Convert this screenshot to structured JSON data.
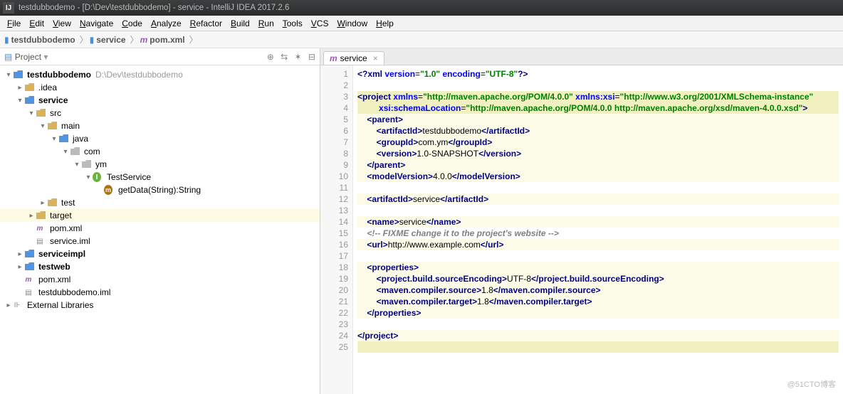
{
  "title": "testdubbodemo - [D:\\Dev\\testdubbodemo] - service - IntelliJ IDEA 2017.2.6",
  "menu": [
    "File",
    "Edit",
    "View",
    "Navigate",
    "Code",
    "Analyze",
    "Refactor",
    "Build",
    "Run",
    "Tools",
    "VCS",
    "Window",
    "Help"
  ],
  "breadcrumbs": [
    {
      "icon": "mod",
      "label": "testdubbodemo"
    },
    {
      "icon": "mod",
      "label": "service"
    },
    {
      "icon": "xml",
      "label": "pom.xml"
    }
  ],
  "sidebar": {
    "title": "Project"
  },
  "tree": [
    {
      "d": 0,
      "exp": "open",
      "icon": "mod",
      "label": "testdubbodemo",
      "suffix": "D:\\Dev\\testdubbodemo",
      "bold": true
    },
    {
      "d": 1,
      "exp": "closed",
      "icon": "fld",
      "label": ".idea"
    },
    {
      "d": 1,
      "exp": "open",
      "icon": "mod",
      "label": "service",
      "bold": true
    },
    {
      "d": 2,
      "exp": "open",
      "icon": "fld",
      "label": "src"
    },
    {
      "d": 3,
      "exp": "open",
      "icon": "fld",
      "label": "main"
    },
    {
      "d": 4,
      "exp": "open",
      "icon": "fldblue",
      "label": "java"
    },
    {
      "d": 5,
      "exp": "open",
      "icon": "pkg",
      "label": "com"
    },
    {
      "d": 6,
      "exp": "open",
      "icon": "pkg",
      "label": "ym"
    },
    {
      "d": 7,
      "exp": "open",
      "icon": "intf",
      "iconText": "I",
      "label": "TestService"
    },
    {
      "d": 8,
      "exp": "none",
      "icon": "meth",
      "iconText": "m",
      "label": "getData(String):String"
    },
    {
      "d": 3,
      "exp": "closed",
      "icon": "fld",
      "label": "test"
    },
    {
      "d": 2,
      "exp": "closed",
      "icon": "fld",
      "label": "target",
      "sel": true
    },
    {
      "d": 2,
      "exp": "none",
      "icon": "xml",
      "iconText": "m",
      "label": "pom.xml"
    },
    {
      "d": 2,
      "exp": "none",
      "icon": "file",
      "label": "service.iml"
    },
    {
      "d": 1,
      "exp": "closed",
      "icon": "mod",
      "label": "serviceimpl",
      "bold": true
    },
    {
      "d": 1,
      "exp": "closed",
      "icon": "mod",
      "label": "testweb",
      "bold": true
    },
    {
      "d": 1,
      "exp": "none",
      "icon": "xml",
      "iconText": "m",
      "label": "pom.xml"
    },
    {
      "d": 1,
      "exp": "none",
      "icon": "file",
      "label": "testdubbodemo.iml"
    },
    {
      "d": 0,
      "exp": "closed",
      "icon": "lib",
      "label": "External Libraries"
    }
  ],
  "editor": {
    "tab": {
      "icon": "m",
      "label": "service"
    },
    "lines": [
      {
        "n": 1,
        "html": "<span class='tag'>&lt;?xml</span> <span class='attr'>version</span>=<span class='val'>\"1.0\"</span> <span class='attr'>encoding</span>=<span class='val'>\"UTF-8\"</span><span class='tag'>?&gt;</span>"
      },
      {
        "n": 2,
        "html": ""
      },
      {
        "n": 3,
        "cls": "hl1",
        "html": "<span class='tag'>&lt;project</span> <span class='attr'>xmlns</span>=<span class='val'>\"http://maven.apache.org/POM/4.0.0\"</span> <span class='attr'>xmlns:xsi</span>=<span class='val'>\"http://www.w3.org/2001/XMLSchema-instance\"</span>"
      },
      {
        "n": 4,
        "cls": "hl1",
        "html": "         <span class='attr'>xsi:schemaLocation</span>=<span class='val'>\"http://maven.apache.org/POM/4.0.0 http://maven.apache.org/xsd/maven-4.0.0.xsd\"</span><span class='tag'>&gt;</span>"
      },
      {
        "n": 5,
        "cls": "hl2",
        "html": "    <span class='tag'>&lt;parent&gt;</span>"
      },
      {
        "n": 6,
        "cls": "hl2",
        "html": "        <span class='tag'>&lt;artifactId&gt;</span>testdubbodemo<span class='tag'>&lt;/artifactId&gt;</span>"
      },
      {
        "n": 7,
        "cls": "hl2",
        "html": "        <span class='tag'>&lt;groupId&gt;</span>com.ym<span class='tag'>&lt;/groupId&gt;</span>"
      },
      {
        "n": 8,
        "cls": "hl2",
        "html": "        <span class='tag'>&lt;version&gt;</span>1.0-SNAPSHOT<span class='tag'>&lt;/version&gt;</span>"
      },
      {
        "n": 9,
        "cls": "hl2",
        "html": "    <span class='tag'>&lt;/parent&gt;</span>"
      },
      {
        "n": 10,
        "cls": "hl2",
        "html": "    <span class='tag'>&lt;modelVersion&gt;</span>4.0.0<span class='tag'>&lt;/modelVersion&gt;</span>"
      },
      {
        "n": 11,
        "html": ""
      },
      {
        "n": 12,
        "cls": "hl2",
        "html": "    <span class='tag'>&lt;artifactId&gt;</span>service<span class='tag'>&lt;/artifactId&gt;</span>"
      },
      {
        "n": 13,
        "html": ""
      },
      {
        "n": 14,
        "cls": "hl2",
        "html": "    <span class='tag'>&lt;name&gt;</span>service<span class='tag'>&lt;/name&gt;</span>"
      },
      {
        "n": 15,
        "html": "    <span class='cmt'>&lt;!-- FIXME change it to the project's website --&gt;</span>"
      },
      {
        "n": 16,
        "cls": "hl2",
        "html": "    <span class='tag'>&lt;url&gt;</span>http://www.example.com<span class='tag'>&lt;/url&gt;</span>"
      },
      {
        "n": 17,
        "html": ""
      },
      {
        "n": 18,
        "cls": "hl2",
        "html": "    <span class='tag'>&lt;properties&gt;</span>"
      },
      {
        "n": 19,
        "cls": "hl2",
        "html": "        <span class='tag'>&lt;project.build.sourceEncoding&gt;</span>UTF-8<span class='tag'>&lt;/project.build.sourceEncoding&gt;</span>"
      },
      {
        "n": 20,
        "cls": "hl2",
        "html": "        <span class='tag'>&lt;maven.compiler.source&gt;</span>1.8<span class='tag'>&lt;/maven.compiler.source&gt;</span>"
      },
      {
        "n": 21,
        "cls": "hl2",
        "html": "        <span class='tag'>&lt;maven.compiler.target&gt;</span>1.8<span class='tag'>&lt;/maven.compiler.target&gt;</span>"
      },
      {
        "n": 22,
        "cls": "hl2",
        "html": "    <span class='tag'>&lt;/properties&gt;</span>"
      },
      {
        "n": 23,
        "html": ""
      },
      {
        "n": 24,
        "cls": "hl2",
        "html": "<span class='tag'>&lt;/project&gt;</span>"
      },
      {
        "n": 25,
        "cls": "hl1",
        "html": ""
      }
    ]
  },
  "watermark": "@51CTO博客"
}
